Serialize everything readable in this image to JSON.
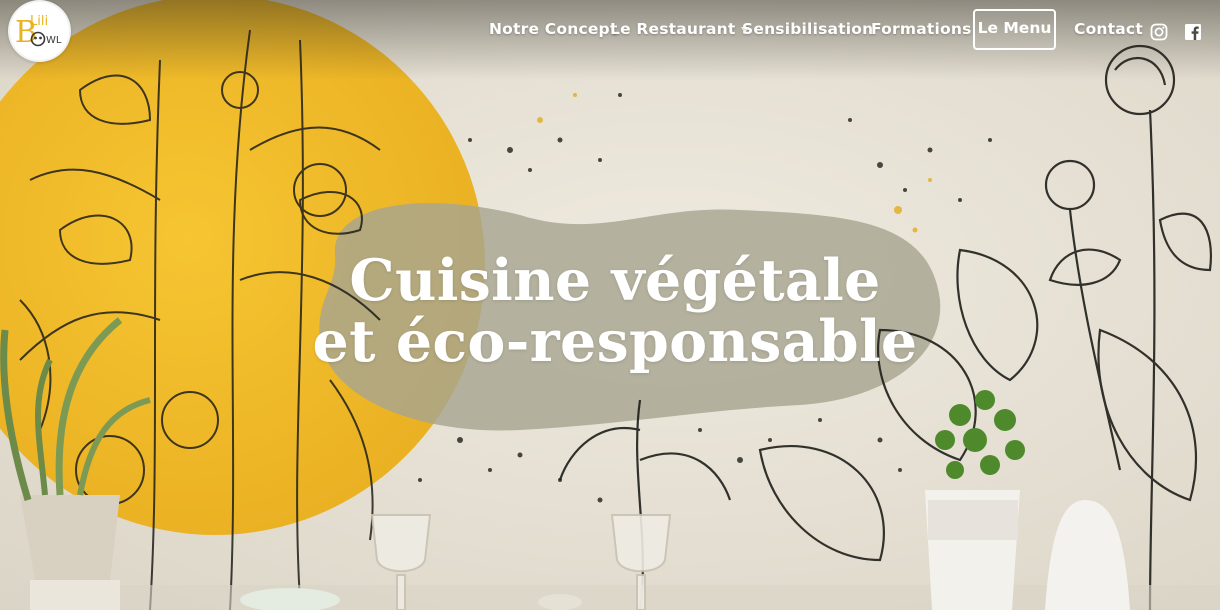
{
  "brand": {
    "logo_text_top": "Lili",
    "logo_text_bottom": "BOWL",
    "logo_letter_b": "B",
    "logo_letters_wl": "WL"
  },
  "nav": {
    "items": [
      {
        "label": "Notre Concept"
      },
      {
        "label": "Le Restaurant"
      },
      {
        "label": "Sensibilisation"
      },
      {
        "label": "Formations"
      }
    ],
    "menu_button": "Le Menu",
    "contact": "Contact",
    "social": [
      "instagram-icon",
      "facebook-icon"
    ]
  },
  "hero": {
    "headline_line1": "Cuisine végétale",
    "headline_line2": "et éco-responsable"
  },
  "colors": {
    "accent_yellow": "#f1bd2a",
    "wall": "#ece7dc",
    "ink": "#1f1f1f",
    "headline": "#ffffff",
    "blob": "#a8a693"
  }
}
